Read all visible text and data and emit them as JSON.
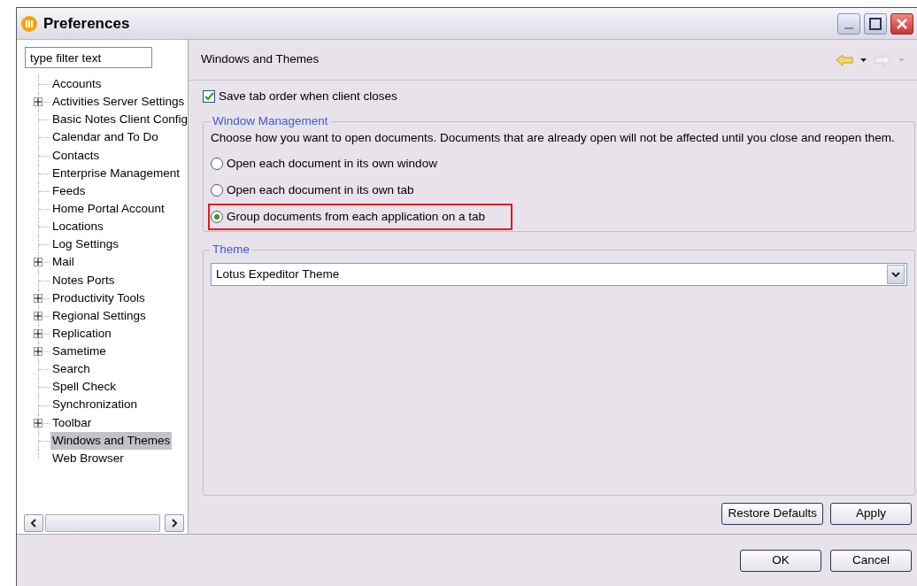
{
  "window": {
    "title": "Preferences"
  },
  "filter": {
    "placeholder": "type filter text"
  },
  "tree": [
    {
      "label": "Accounts",
      "expandable": false,
      "selected": false
    },
    {
      "label": "Activities Server Settings",
      "expandable": true,
      "selected": false
    },
    {
      "label": "Basic Notes Client Config",
      "expandable": false,
      "selected": false
    },
    {
      "label": "Calendar and To Do",
      "expandable": false,
      "selected": false
    },
    {
      "label": "Contacts",
      "expandable": false,
      "selected": false
    },
    {
      "label": "Enterprise Management",
      "expandable": false,
      "selected": false
    },
    {
      "label": "Feeds",
      "expandable": false,
      "selected": false
    },
    {
      "label": "Home Portal Account",
      "expandable": false,
      "selected": false
    },
    {
      "label": "Locations",
      "expandable": false,
      "selected": false
    },
    {
      "label": "Log Settings",
      "expandable": false,
      "selected": false
    },
    {
      "label": "Mail",
      "expandable": true,
      "selected": false
    },
    {
      "label": "Notes Ports",
      "expandable": false,
      "selected": false
    },
    {
      "label": "Productivity Tools",
      "expandable": true,
      "selected": false
    },
    {
      "label": "Regional Settings",
      "expandable": true,
      "selected": false
    },
    {
      "label": "Replication",
      "expandable": true,
      "selected": false
    },
    {
      "label": "Sametime",
      "expandable": true,
      "selected": false
    },
    {
      "label": "Search",
      "expandable": false,
      "selected": false
    },
    {
      "label": "Spell Check",
      "expandable": false,
      "selected": false
    },
    {
      "label": "Synchronization",
      "expandable": false,
      "selected": false
    },
    {
      "label": "Toolbar",
      "expandable": true,
      "selected": false
    },
    {
      "label": "Windows and Themes",
      "expandable": false,
      "selected": true
    },
    {
      "label": "Web Browser",
      "expandable": false,
      "selected": false
    }
  ],
  "page": {
    "title": "Windows and Themes",
    "save_tab_order": {
      "label": "Save tab order when client closes",
      "checked": true
    },
    "window_management": {
      "legend": "Window Management",
      "description": "Choose how you want to open documents.  Documents that are already open will not be affected until you close and reopen them.",
      "options": [
        {
          "label": "Open each document in its own window",
          "selected": false,
          "highlighted": false
        },
        {
          "label": "Open each document in its own tab",
          "selected": false,
          "highlighted": false
        },
        {
          "label": "Group documents from each application on a tab",
          "selected": true,
          "highlighted": true
        }
      ]
    },
    "theme": {
      "legend": "Theme",
      "value": "Lotus Expeditor Theme"
    },
    "buttons": [
      "Restore Defaults",
      "Apply"
    ]
  },
  "dialog_buttons": [
    "OK",
    "Cancel"
  ]
}
